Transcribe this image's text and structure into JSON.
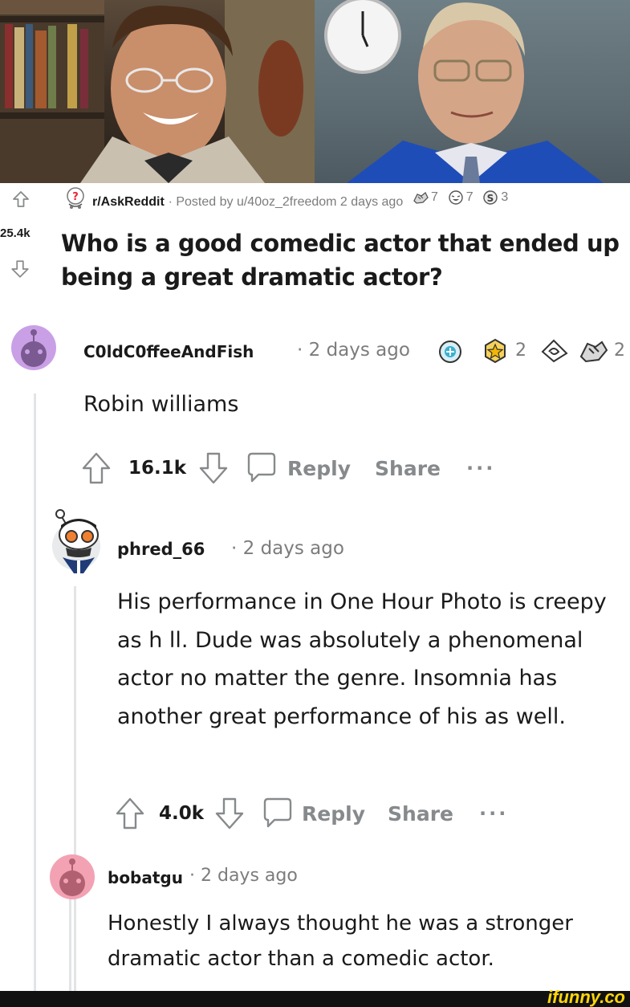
{
  "post": {
    "subreddit": "r/AskReddit",
    "posted_by": "· Posted by u/40oz_2freedom 2 days ago",
    "award_counts": [
      "7",
      "7",
      "3"
    ],
    "score": "25.4k",
    "title": "Who is a good comedic actor that ended up being a great dramatic actor?"
  },
  "comments": [
    {
      "author": "C0ldC0ffeeAndFish",
      "time": "· 2 days ago",
      "award_counts": [
        "2",
        "2"
      ],
      "text": "Robin williams",
      "score": "16.1k",
      "reply_label": "Reply",
      "share_label": "Share",
      "more": "···"
    },
    {
      "author": "phred_66",
      "time": "· 2 days ago",
      "text": "His performance in One Hour Photo is creepy as h  ll. Dude was absolutely a phenomenal actor no matter the genre. Insomnia has another great performance of his as well.",
      "score": "4.0k",
      "reply_label": "Reply",
      "share_label": "Share",
      "more": "···"
    },
    {
      "author": "bobatgu",
      "time": "· 2 days ago",
      "text": "Honestly I always thought he was a stronger dramatic actor than a comedic actor."
    }
  ],
  "watermark": "ifunny.co",
  "colors": {
    "upvote_outline": "#878a8c",
    "avatar_purple": "#c9a0e6",
    "avatar_pink": "#f3a2b3",
    "brand_yellow": "#ffd60a"
  }
}
